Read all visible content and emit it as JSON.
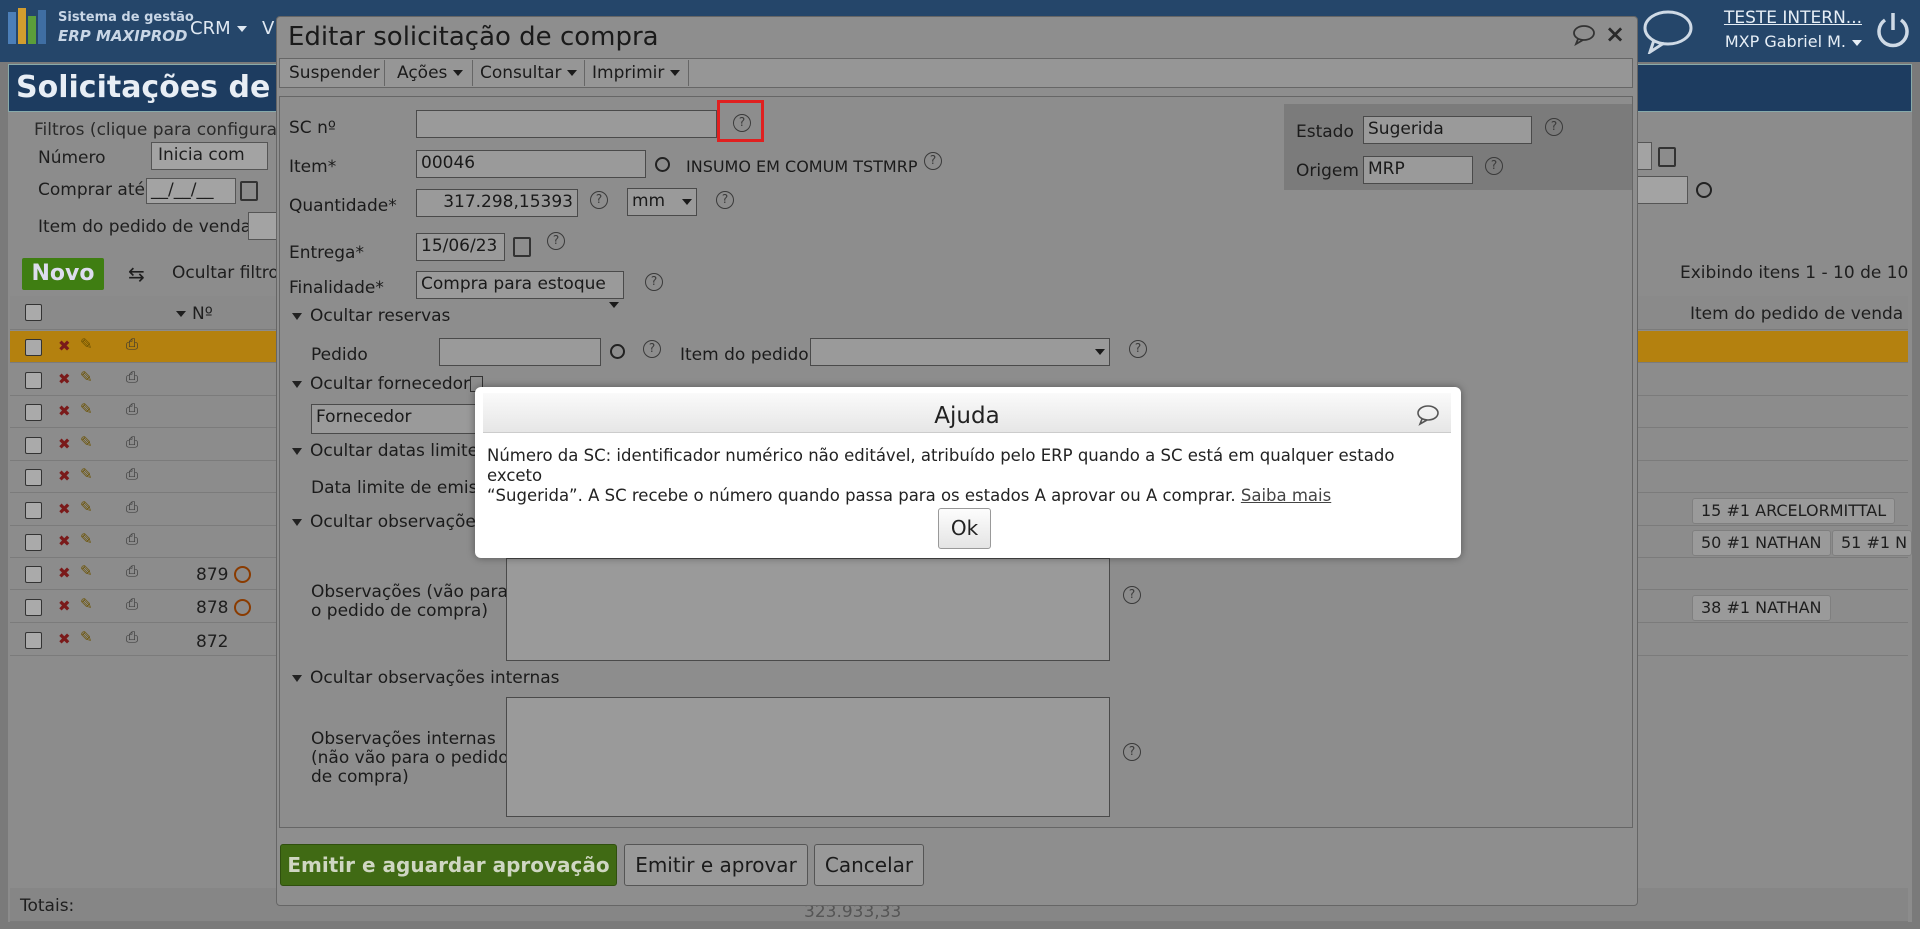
{
  "topbar": {
    "brand_line1": "Sistema de gestão",
    "brand_line2": "ERP MAXIPROD",
    "nav": [
      "CRM",
      "V"
    ],
    "user_company": "TESTE INTERN...",
    "user_name": "MXP Gabriel M."
  },
  "page": {
    "title": "Solicitações de",
    "filters_label": "Filtros (clique para configurar",
    "filter_numero_label": "Número",
    "filter_numero_value": "Inicia com",
    "filter_comprar_label": "Comprar até",
    "filter_comprar_value": "__/__/__",
    "filter_item_pedido_label": "Item do pedido de venda",
    "novo_label": "Novo",
    "ocultar_filtros": "Ocultar filtros",
    "exibindo": "Exibindo itens 1 - 10 de 10",
    "col_numero": "Nº",
    "col_item_pedido": "Item do pedido de venda",
    "rows": [
      {
        "num": "",
        "tags": []
      },
      {
        "num": "",
        "tags": []
      },
      {
        "num": "",
        "tags": []
      },
      {
        "num": "",
        "tags": []
      },
      {
        "num": "",
        "tags": []
      },
      {
        "num": "",
        "tags": [
          "15 #1 ARCELORMITTAL"
        ]
      },
      {
        "num": "",
        "tags": [
          "50 #1 NATHAN",
          "51 #1 N"
        ]
      },
      {
        "num": "879",
        "tags": []
      },
      {
        "num": "878",
        "tags": [
          "38 #1 NATHAN"
        ]
      },
      {
        "num": "872",
        "tags": []
      }
    ],
    "totais_label": "Totais:",
    "totais_value": "323.933,33"
  },
  "edit_dialog": {
    "title": "Editar solicitação de compra",
    "menu": [
      "Suspender",
      "Ações",
      "Consultar",
      "Imprimir"
    ],
    "sc_label": "SC nº",
    "sc_value": "",
    "item_label": "Item*",
    "item_value": "00046",
    "item_desc": "INSUMO EM COMUM TSTMRP",
    "quantidade_label": "Quantidade*",
    "quantidade_value": "317.298,15393",
    "unidade_value": "mm",
    "entrega_label": "Entrega*",
    "entrega_value": "15/06/23",
    "finalidade_label": "Finalidade*",
    "finalidade_value": "Compra para estoque",
    "estado_label": "Estado",
    "estado_value": "Sugerida",
    "origem_label": "Origem",
    "origem_value": "MRP",
    "sect_reservas": "Ocultar reservas",
    "pedido_label": "Pedido",
    "item_pedido_label": "Item do pedido",
    "sect_fornecedor": "Ocultar fornecedor",
    "fornecedor_value": "Fornecedor",
    "sect_datas": "Ocultar datas limite d",
    "data_limite_label": "Data limite de emiss",
    "sect_observacoes": "Ocultar observações",
    "obs_label_1": "Observações (vão para",
    "obs_label_2": "o pedido de compra)",
    "sect_obs_internas": "Ocultar observações internas",
    "obs_int_label_1": "Observações internas",
    "obs_int_label_2": "(não vão para o pedido",
    "obs_int_label_3": "de compra)",
    "btn_emitir_aguardar": "Emitir e aguardar aprovação",
    "btn_emitir_aprovar": "Emitir e aprovar",
    "btn_cancelar": "Cancelar"
  },
  "help_dialog": {
    "title": "Ajuda",
    "text_1": "Número da SC: identificador numérico não editável, atribuído pelo ERP quando a SC está em qualquer estado exceto",
    "text_2": "“Sugerida”. A SC recebe o número quando passa para os estados A aprovar ou A comprar.",
    "link": "Saiba mais",
    "ok": "Ok"
  },
  "colors": {
    "accent_green": "#5a9a1e",
    "topbar": "#25466a",
    "highlight": "#e02020"
  }
}
